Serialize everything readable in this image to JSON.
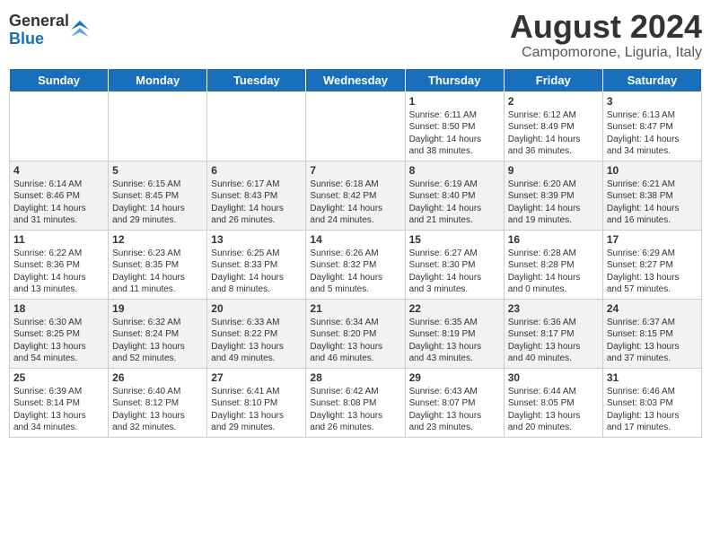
{
  "logo": {
    "general": "General",
    "blue": "Blue"
  },
  "title": "August 2024",
  "subtitle": "Campomorone, Liguria, Italy",
  "weekdays": [
    "Sunday",
    "Monday",
    "Tuesday",
    "Wednesday",
    "Thursday",
    "Friday",
    "Saturday"
  ],
  "weeks": [
    [
      {
        "day": "",
        "info": ""
      },
      {
        "day": "",
        "info": ""
      },
      {
        "day": "",
        "info": ""
      },
      {
        "day": "",
        "info": ""
      },
      {
        "day": "1",
        "info": "Sunrise: 6:11 AM\nSunset: 8:50 PM\nDaylight: 14 hours\nand 38 minutes."
      },
      {
        "day": "2",
        "info": "Sunrise: 6:12 AM\nSunset: 8:49 PM\nDaylight: 14 hours\nand 36 minutes."
      },
      {
        "day": "3",
        "info": "Sunrise: 6:13 AM\nSunset: 8:47 PM\nDaylight: 14 hours\nand 34 minutes."
      }
    ],
    [
      {
        "day": "4",
        "info": "Sunrise: 6:14 AM\nSunset: 8:46 PM\nDaylight: 14 hours\nand 31 minutes."
      },
      {
        "day": "5",
        "info": "Sunrise: 6:15 AM\nSunset: 8:45 PM\nDaylight: 14 hours\nand 29 minutes."
      },
      {
        "day": "6",
        "info": "Sunrise: 6:17 AM\nSunset: 8:43 PM\nDaylight: 14 hours\nand 26 minutes."
      },
      {
        "day": "7",
        "info": "Sunrise: 6:18 AM\nSunset: 8:42 PM\nDaylight: 14 hours\nand 24 minutes."
      },
      {
        "day": "8",
        "info": "Sunrise: 6:19 AM\nSunset: 8:40 PM\nDaylight: 14 hours\nand 21 minutes."
      },
      {
        "day": "9",
        "info": "Sunrise: 6:20 AM\nSunset: 8:39 PM\nDaylight: 14 hours\nand 19 minutes."
      },
      {
        "day": "10",
        "info": "Sunrise: 6:21 AM\nSunset: 8:38 PM\nDaylight: 14 hours\nand 16 minutes."
      }
    ],
    [
      {
        "day": "11",
        "info": "Sunrise: 6:22 AM\nSunset: 8:36 PM\nDaylight: 14 hours\nand 13 minutes."
      },
      {
        "day": "12",
        "info": "Sunrise: 6:23 AM\nSunset: 8:35 PM\nDaylight: 14 hours\nand 11 minutes."
      },
      {
        "day": "13",
        "info": "Sunrise: 6:25 AM\nSunset: 8:33 PM\nDaylight: 14 hours\nand 8 minutes."
      },
      {
        "day": "14",
        "info": "Sunrise: 6:26 AM\nSunset: 8:32 PM\nDaylight: 14 hours\nand 5 minutes."
      },
      {
        "day": "15",
        "info": "Sunrise: 6:27 AM\nSunset: 8:30 PM\nDaylight: 14 hours\nand 3 minutes."
      },
      {
        "day": "16",
        "info": "Sunrise: 6:28 AM\nSunset: 8:28 PM\nDaylight: 14 hours\nand 0 minutes."
      },
      {
        "day": "17",
        "info": "Sunrise: 6:29 AM\nSunset: 8:27 PM\nDaylight: 13 hours\nand 57 minutes."
      }
    ],
    [
      {
        "day": "18",
        "info": "Sunrise: 6:30 AM\nSunset: 8:25 PM\nDaylight: 13 hours\nand 54 minutes."
      },
      {
        "day": "19",
        "info": "Sunrise: 6:32 AM\nSunset: 8:24 PM\nDaylight: 13 hours\nand 52 minutes."
      },
      {
        "day": "20",
        "info": "Sunrise: 6:33 AM\nSunset: 8:22 PM\nDaylight: 13 hours\nand 49 minutes."
      },
      {
        "day": "21",
        "info": "Sunrise: 6:34 AM\nSunset: 8:20 PM\nDaylight: 13 hours\nand 46 minutes."
      },
      {
        "day": "22",
        "info": "Sunrise: 6:35 AM\nSunset: 8:19 PM\nDaylight: 13 hours\nand 43 minutes."
      },
      {
        "day": "23",
        "info": "Sunrise: 6:36 AM\nSunset: 8:17 PM\nDaylight: 13 hours\nand 40 minutes."
      },
      {
        "day": "24",
        "info": "Sunrise: 6:37 AM\nSunset: 8:15 PM\nDaylight: 13 hours\nand 37 minutes."
      }
    ],
    [
      {
        "day": "25",
        "info": "Sunrise: 6:39 AM\nSunset: 8:14 PM\nDaylight: 13 hours\nand 34 minutes."
      },
      {
        "day": "26",
        "info": "Sunrise: 6:40 AM\nSunset: 8:12 PM\nDaylight: 13 hours\nand 32 minutes."
      },
      {
        "day": "27",
        "info": "Sunrise: 6:41 AM\nSunset: 8:10 PM\nDaylight: 13 hours\nand 29 minutes."
      },
      {
        "day": "28",
        "info": "Sunrise: 6:42 AM\nSunset: 8:08 PM\nDaylight: 13 hours\nand 26 minutes."
      },
      {
        "day": "29",
        "info": "Sunrise: 6:43 AM\nSunset: 8:07 PM\nDaylight: 13 hours\nand 23 minutes."
      },
      {
        "day": "30",
        "info": "Sunrise: 6:44 AM\nSunset: 8:05 PM\nDaylight: 13 hours\nand 20 minutes."
      },
      {
        "day": "31",
        "info": "Sunrise: 6:46 AM\nSunset: 8:03 PM\nDaylight: 13 hours\nand 17 minutes."
      }
    ]
  ]
}
